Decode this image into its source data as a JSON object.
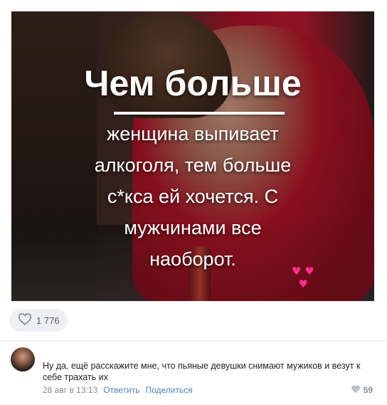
{
  "post": {
    "image": {
      "headline": "Чем больше",
      "text_lines": [
        "женщина выпивает",
        "алкоголя, тем больше",
        "с*кса ей хочется. С",
        "мужчинами все",
        "наоборот."
      ]
    },
    "likes": {
      "icon": "heart-outline-icon",
      "count": "1 776"
    }
  },
  "comment": {
    "text": "Ну да, ещё расскажите мне, что пьяные девушки снимают мужиков и везут к себе трахать их",
    "timestamp": "28 авг в 13:13",
    "reply_label": "Ответить",
    "share_label": "Поделиться",
    "likes": {
      "icon": "heart-filled-icon",
      "count": "59"
    }
  },
  "colors": {
    "link": "#5181b8",
    "meta": "#828a99",
    "like_pill_bg": "#eef0f3",
    "heart_accent": "#ff2f8a"
  }
}
